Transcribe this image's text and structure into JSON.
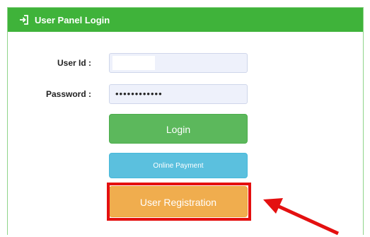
{
  "header": {
    "title": "User Panel Login",
    "icon": "login-icon"
  },
  "form": {
    "userid_label": "User Id :",
    "userid_value": "",
    "password_label": "Password :",
    "password_value": "••••••••••••"
  },
  "buttons": {
    "login": "Login",
    "online_payment": "Online Payment",
    "user_registration": "User Registration"
  },
  "colors": {
    "header": "#3fb33a",
    "login": "#5cb85c",
    "payment": "#5bc0de",
    "registration": "#f0ad4e",
    "annotation": "#e41010"
  }
}
